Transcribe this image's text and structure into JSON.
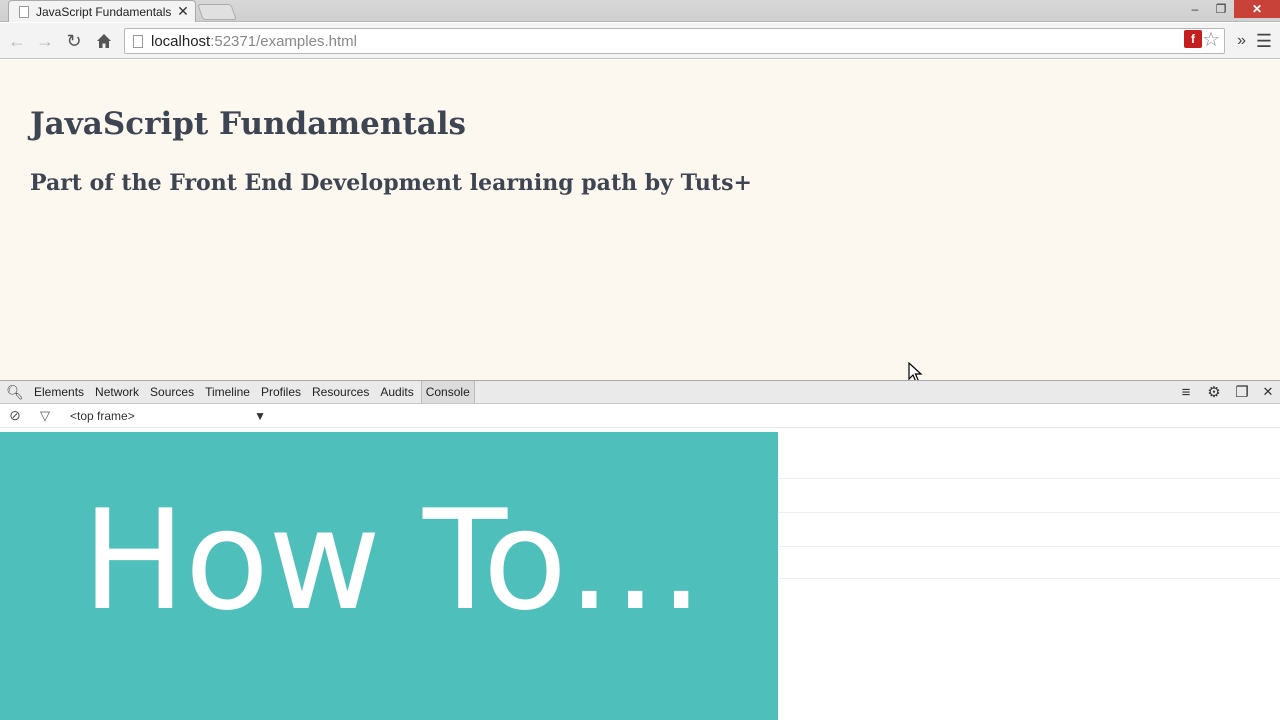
{
  "browser": {
    "tab_title": "JavaScript Fundamentals",
    "tab_close": "✕",
    "url_host": "localhost",
    "url_rest": ":52371/examples.html"
  },
  "page": {
    "title": "JavaScript Fundamentals",
    "subtitle": "Part of the Front End Development learning path by Tuts+"
  },
  "devtools": {
    "tabs": [
      "Elements",
      "Network",
      "Sources",
      "Timeline",
      "Profiles",
      "Resources",
      "Audits",
      "Console"
    ],
    "active_tab": "Console",
    "frame_select": "<top frame>"
  },
  "overlay": {
    "text": "How To…",
    "color": "#4fbfbc"
  },
  "icons": {
    "back": "arrow-left-icon",
    "forward": "arrow-right-icon",
    "reload": "reload-icon",
    "home": "home-icon",
    "flash": "flash-icon",
    "bookmark": "star-icon",
    "menu": "hamburger-icon"
  }
}
